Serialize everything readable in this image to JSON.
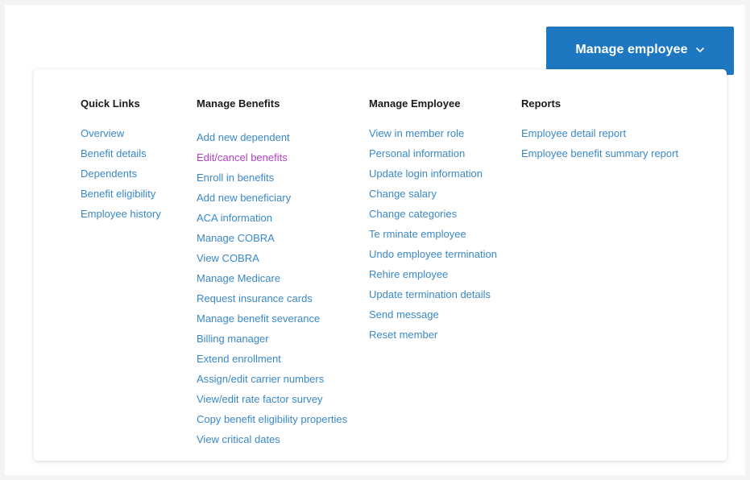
{
  "trigger": {
    "label": "Manage employee",
    "icon": "chevron-down-icon",
    "color": "#1d78c1"
  },
  "colors": {
    "link": "#3a88c7",
    "visited_link": "#b341c8",
    "heading": "#1a1a1a"
  },
  "columns": [
    {
      "heading": "Quick Links",
      "items": [
        "Overview",
        "Benefit details",
        "Dependents",
        "Benefit eligibility",
        "Employee history"
      ]
    },
    {
      "heading": "Manage Benefits",
      "items": [
        "Add new dependent",
        "Edit/cancel benefits",
        "Enroll in benefits",
        "Add new beneficiary",
        "ACA information",
        "Manage COBRA",
        "View COBRA",
        "Manage Medicare",
        "Request insurance cards",
        "Manage benefit severance",
        "Billing manager",
        "Extend enrollment",
        "Assign/edit carrier numbers",
        "View/edit rate factor survey",
        "Copy benefit eligibility properties",
        "View critical dates"
      ],
      "visited_item": "Edit/cancel benefits"
    },
    {
      "heading": "Manage Employee",
      "items": [
        "View in member role",
        "Personal information",
        "Update login information",
        "Change salary",
        "Change categories",
        "Te rminate employee",
        "Undo employee termination",
        "Rehire employee",
        "Update termination details",
        "Send message",
        "Reset member"
      ]
    },
    {
      "heading": "Reports",
      "items": [
        "Employee detail report",
        "Employee benefit summary report"
      ]
    }
  ]
}
